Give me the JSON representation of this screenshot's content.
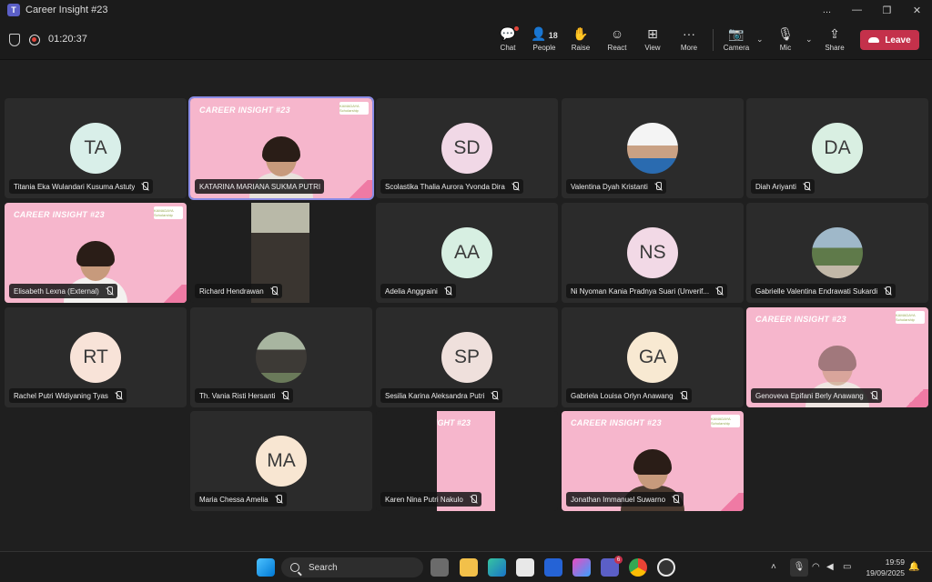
{
  "window": {
    "title": "Career Insight #23",
    "app_icon_letter": "T",
    "controls": [
      "...",
      "—",
      "❐",
      "✕"
    ]
  },
  "meeting": {
    "timer": "01:20:37",
    "toolbar": [
      {
        "id": "chat",
        "label": "Chat",
        "icon": "chat-icon",
        "glyph": "💬"
      },
      {
        "id": "people",
        "label": "People",
        "icon": "people-icon",
        "glyph": "👤",
        "count": "18"
      },
      {
        "id": "raise",
        "label": "Raise",
        "icon": "hand-icon",
        "glyph": "✋"
      },
      {
        "id": "react",
        "label": "React",
        "icon": "smile-icon",
        "glyph": "☺"
      },
      {
        "id": "view",
        "label": "View",
        "icon": "grid-icon",
        "glyph": "⊞"
      },
      {
        "id": "more",
        "label": "More",
        "icon": "more-icon",
        "glyph": "···"
      },
      {
        "id": "camera",
        "label": "Camera",
        "icon": "camera-off-icon",
        "glyph": "📷"
      },
      {
        "id": "mic",
        "label": "Mic",
        "icon": "mic-off-icon",
        "glyph": "🎙"
      },
      {
        "id": "share",
        "label": "Share",
        "icon": "share-icon",
        "glyph": "⇪"
      }
    ],
    "leave_label": "Leave"
  },
  "banner_text": "CAREER INSIGHT #23",
  "partial_banner_text": "IGHT #23",
  "logo_text": "KAMADAYA Scholarship",
  "participants": [
    {
      "name": "Titania Eka Wulandari Kusuma Astuty",
      "initials": "TA",
      "color": "#d9efe9"
    },
    {
      "name": "KATARINA MARIANA SUKMA PUTRI",
      "video": "pink",
      "active": true
    },
    {
      "name": "Scolastika Thalia Aurora Yvonda Dira",
      "initials": "SD",
      "color": "#f1d8e6"
    },
    {
      "name": "Valentina Dyah Kristanti",
      "photo": true
    },
    {
      "name": "Diah Ariyanti",
      "initials": "DA",
      "color": "#d9efe2"
    },
    {
      "name": "Elisabeth Lexna (External)",
      "video": "pink"
    },
    {
      "name": "Richard Hendrawan",
      "video": "dark"
    },
    {
      "name": "Adelia Anggraini",
      "initials": "AA",
      "color": "#d7efe2"
    },
    {
      "name": "Ni Nyoman Kania Pradnya Suari (Unverif...",
      "initials": "NS",
      "color": "#f2d9e6"
    },
    {
      "name": "Gabrielle Valentina Endrawati Sukardi",
      "photo": true
    },
    {
      "name": "Rachel Putri Widiyaning Tyas",
      "initials": "RT",
      "color": "#f8e3d8"
    },
    {
      "name": "Th. Vania Risti Hersanti",
      "photo": true
    },
    {
      "name": "Sesilia Karina Aleksandra Putri",
      "initials": "SP",
      "color": "#efe0dc"
    },
    {
      "name": "Gabriela Louisa Orlyn Anawang",
      "initials": "GA",
      "color": "#f8e9d2"
    },
    {
      "name": "Genoveva Epifani Berly Anawang",
      "video": "pink"
    },
    {
      "name": "Maria Chessa Amelia",
      "initials": "MA",
      "color": "#f8e6d2"
    },
    {
      "name": "Karen Nina Putri Nakulo",
      "video": "pinkstrip"
    },
    {
      "name": "Jonathan Immanuel Suwarno",
      "video": "pink"
    }
  ],
  "taskbar": {
    "search_label": "Search",
    "time": "19:59",
    "date": "19/09/2025",
    "teams_badge": "6"
  },
  "colors": {
    "accent": "#5b5fc7",
    "leave": "#c4314b",
    "tile_bg": "#2b2b2b",
    "banner_pink": "#f6b6cc"
  }
}
